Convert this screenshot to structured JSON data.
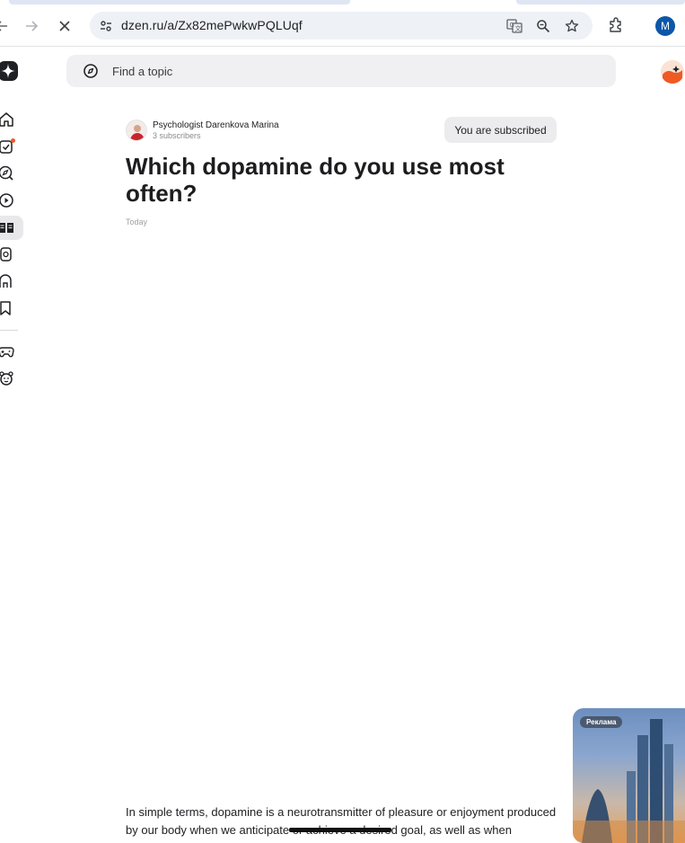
{
  "browser": {
    "url": "dzen.ru/a/Zx82mePwkwPQLUqf",
    "profile_initial": "M"
  },
  "header": {
    "search_placeholder": "Find a topic"
  },
  "sidebar": {
    "items": [
      {
        "icon": "home-icon"
      },
      {
        "icon": "subscriptions-icon",
        "badge": true
      },
      {
        "icon": "explore-icon"
      },
      {
        "icon": "video-icon"
      },
      {
        "icon": "articles-icon",
        "active": true
      },
      {
        "icon": "shorts-icon"
      },
      {
        "icon": "stores-icon"
      },
      {
        "icon": "bookmark-icon"
      },
      {
        "icon": "games-icon"
      },
      {
        "icon": "kids-icon"
      }
    ]
  },
  "article": {
    "author_name": "Psychologist Darenkova Marina",
    "author_subscribers": "3 subscribers",
    "subscribe_label": "You are subscribed",
    "title": "Which dopamine do you use most often?",
    "date": "Today",
    "body_lines": [
      "In simple terms, dopamine is a neurotransmitter of pleasure or enjoyment produced",
      "by our body when we anticipate or achieve a desired goal, as well as when"
    ]
  },
  "ad": {
    "label": "Реклама"
  },
  "colors": {
    "accent": "#f05a28",
    "profile": "#0b57a8",
    "button_bg": "#ececee"
  }
}
